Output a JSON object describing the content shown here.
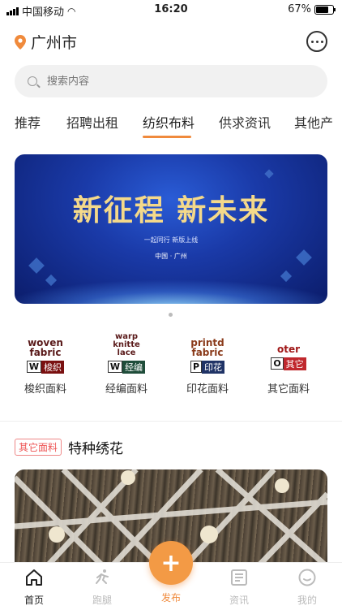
{
  "status": {
    "carrier": "中国移动",
    "time": "16:20",
    "battery": "67%",
    "battery_level": 0.67
  },
  "header": {
    "city": "广州市"
  },
  "search": {
    "placeholder": "搜索内容"
  },
  "tabs": [
    {
      "label": "推荐"
    },
    {
      "label": "招聘出租"
    },
    {
      "label": "纺织布料",
      "active": true
    },
    {
      "label": "供求资讯"
    },
    {
      "label": "其他产"
    }
  ],
  "banner": {
    "title": "新征程  新未来",
    "subtitle": "一起同行  新版上线",
    "location": "中国 · 广州"
  },
  "categories": [
    {
      "en": "woven\nfabric",
      "letter": "W",
      "cn_badge": "梭织",
      "badge_color": "#7a1010",
      "label": "梭织面料"
    },
    {
      "en": "warp\nknitte\nlace",
      "letter": "W",
      "cn_badge": "经编",
      "badge_color": "#1f4d3a",
      "label": "经编面料"
    },
    {
      "en": "printd\nfabric",
      "letter": "P",
      "cn_badge": "印花",
      "badge_color": "#1f3366",
      "label": "印花面料"
    },
    {
      "en": "oter",
      "letter": "O",
      "cn_badge": "其它",
      "badge_color": "#c0282d",
      "label": "其它面料"
    }
  ],
  "post": {
    "tag": "其它面料",
    "title": "特种绣花"
  },
  "tabbar": {
    "items": [
      {
        "label": "首页",
        "icon": "home-icon"
      },
      {
        "label": "跑腿",
        "icon": "runner-icon"
      },
      {
        "label": "资讯",
        "icon": "news-icon"
      },
      {
        "label": "我的",
        "icon": "profile-icon"
      }
    ],
    "publish_label": "发布",
    "publish_symbol": "+"
  },
  "colors": {
    "accent": "#f08a3c",
    "tag": "#e55555"
  }
}
